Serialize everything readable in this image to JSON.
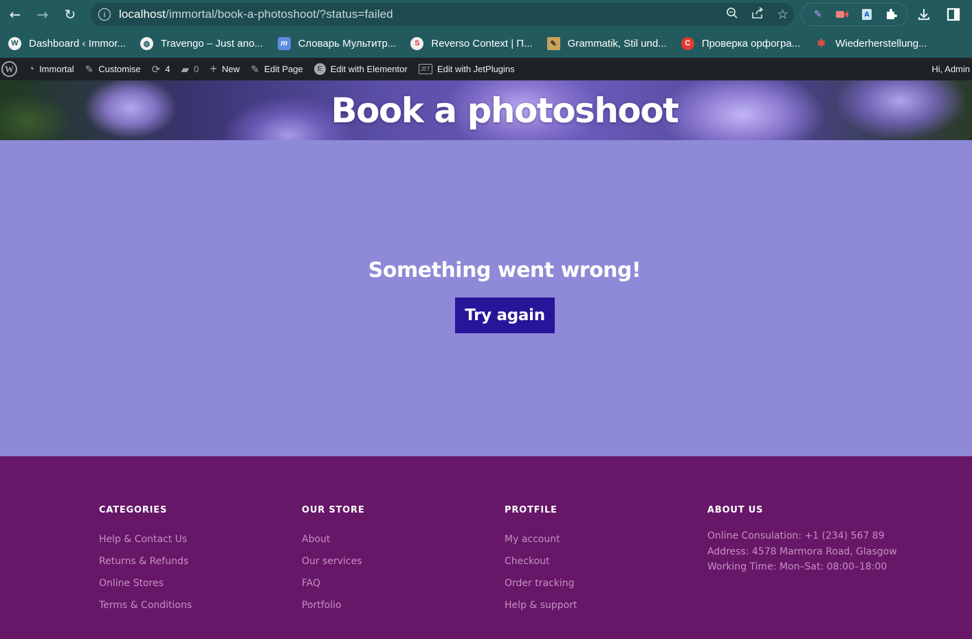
{
  "browser": {
    "url_host": "localhost",
    "url_path": "/immortal/book-a-photoshoot/?status=failed",
    "bookmarks": [
      {
        "label": "Dashboard ‹ Immor...",
        "icon": "wordpress-icon"
      },
      {
        "label": "Travengo – Just ano...",
        "icon": "globe-icon"
      },
      {
        "label": "Словарь Мультитр...",
        "icon": "multitran-icon"
      },
      {
        "label": "Reverso Context | П...",
        "icon": "reverso-icon"
      },
      {
        "label": "Grammatik, Stil und...",
        "icon": "grammatik-icon"
      },
      {
        "label": "Проверка орфогра...",
        "icon": "spellcheck-icon"
      },
      {
        "label": "Wiederherstellung...",
        "icon": "recovery-icon"
      }
    ]
  },
  "adminbar": {
    "site": "Immortal",
    "customise": "Customise",
    "updates": "4",
    "comments": "0",
    "new": "New",
    "edit_page": "Edit Page",
    "edit_elementor": "Edit with Elementor",
    "edit_jet": "Edit with JetPlugins",
    "greeting": "Hi, Admin"
  },
  "page": {
    "title": "Book a photoshoot",
    "message": "Something went wrong!",
    "try_again": "Try again"
  },
  "footer": {
    "categories": {
      "heading": "CATEGORIES",
      "items": [
        "Help & Contact Us",
        "Returns & Refunds",
        "Online Stores",
        "Terms & Conditions"
      ]
    },
    "store": {
      "heading": "OUR STORE",
      "items": [
        "About",
        "Our services",
        "FAQ",
        "Portfolio"
      ]
    },
    "profile": {
      "heading": "PROTFILE",
      "items": [
        "My account",
        "Checkout",
        "Order tracking",
        "Help & support"
      ]
    },
    "about": {
      "heading": "ABOUT US",
      "lines": [
        "Online Consulation: +1 (234) 567 89",
        "Address: 4578 Marmora Road, Glasgow",
        "Working Time: Mon–Sat: 08:00–18:00"
      ]
    }
  },
  "colors": {
    "toolbar": "#235a5e",
    "adminbar": "#1e2226",
    "main_bg": "#8e8ad8",
    "button": "#27169a",
    "footer_bg": "#661767",
    "footer_link": "#c690c4"
  }
}
